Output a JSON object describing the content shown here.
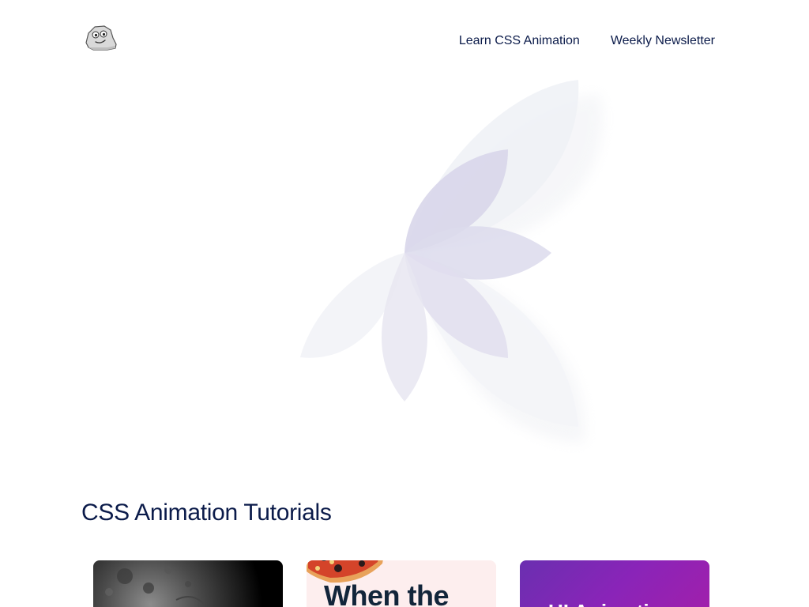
{
  "header": {
    "logo": {
      "icon": "rock-mascot-icon"
    },
    "nav": [
      {
        "label": "Learn CSS Animation"
      },
      {
        "label": "Weekly Newsletter"
      }
    ]
  },
  "hero": {
    "icon": "petal-flower-icon",
    "colors": {
      "petal": "#d8d6ea",
      "petal_faint": "#eef0f6"
    }
  },
  "tutorials": {
    "title": "CSS Animation Tutorials",
    "cards": [
      {
        "image": "moon-image",
        "title": ""
      },
      {
        "image": "pizza-image",
        "title": "When the"
      },
      {
        "image": "purple-gradient",
        "title": "UI Animation"
      }
    ]
  },
  "colors": {
    "text": "#0b1b4a",
    "card_pink": "#fdeeee",
    "card_purple": "#8a24b8"
  }
}
